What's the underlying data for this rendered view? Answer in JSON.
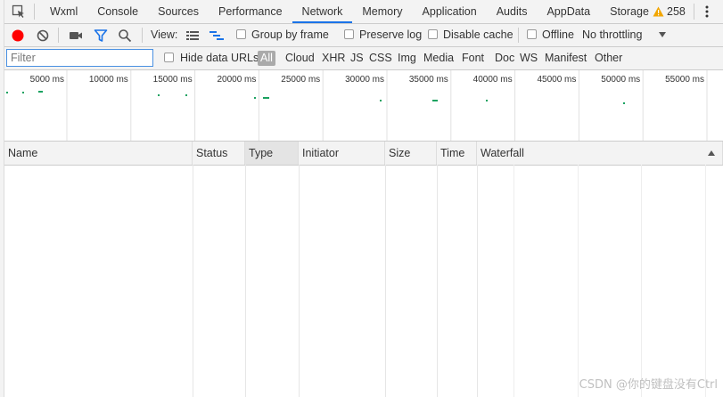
{
  "tabs": [
    {
      "label": "Wxml",
      "active": false
    },
    {
      "label": "Console",
      "active": false
    },
    {
      "label": "Sources",
      "active": false
    },
    {
      "label": "Performance",
      "active": false
    },
    {
      "label": "Network",
      "active": true
    },
    {
      "label": "Memory",
      "active": false
    },
    {
      "label": "Application",
      "active": false
    },
    {
      "label": "Audits",
      "active": false
    },
    {
      "label": "AppData",
      "active": false
    },
    {
      "label": "Storage",
      "active": false
    }
  ],
  "warnings": {
    "count": "258",
    "icon": "warning-icon",
    "color": "#f2a600"
  },
  "toolbar": {
    "record_color": "#ff0000",
    "view_label": "View:",
    "group_by_frame": "Group by frame",
    "preserve_log": "Preserve log",
    "disable_cache": "Disable cache",
    "offline": "Offline",
    "throttling": "No throttling"
  },
  "filter": {
    "placeholder": "Filter",
    "value": "",
    "hide_data_urls": "Hide data URLs",
    "types": [
      "All",
      "Cloud",
      "XHR",
      "JS",
      "CSS",
      "Img",
      "Media",
      "Font",
      "Doc",
      "WS",
      "Manifest",
      "Other"
    ],
    "active_type": "All"
  },
  "overview": {
    "ticks": [
      "5000 ms",
      "10000 ms",
      "15000 ms",
      "20000 ms",
      "25000 ms",
      "30000 ms",
      "35000 ms",
      "40000 ms",
      "45000 ms",
      "50000 ms",
      "55000 ms"
    ],
    "marker_color": "#1aa260"
  },
  "table": {
    "columns": [
      "Name",
      "Status",
      "Type",
      "Initiator",
      "Size",
      "Time",
      "Waterfall"
    ],
    "sorted_column": "Type",
    "rows": []
  },
  "watermark": "CSDN @你的键盘没有Ctrl"
}
